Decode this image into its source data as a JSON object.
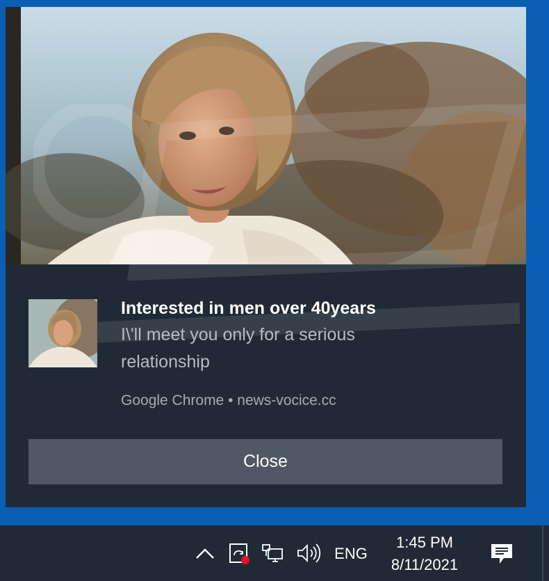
{
  "notification": {
    "title": "Interested in men over 40years",
    "message": "I\\'ll meet you only for a serious relationship",
    "source": "Google Chrome • news-vocice.cc",
    "close_label": "Close"
  },
  "taskbar": {
    "language": "ENG",
    "time": "1:45 PM",
    "date": "8/11/2021",
    "icons": [
      "chevron-up-icon",
      "windows-defender-icon",
      "network-icon",
      "volume-icon",
      "action-center-icon"
    ]
  },
  "colors": {
    "desktop": "#0a5fb4",
    "toast_bg": "#1f2a36",
    "close_button": "#4e5965",
    "taskbar": "#1f2a36",
    "alert_dot": "#e81123"
  }
}
